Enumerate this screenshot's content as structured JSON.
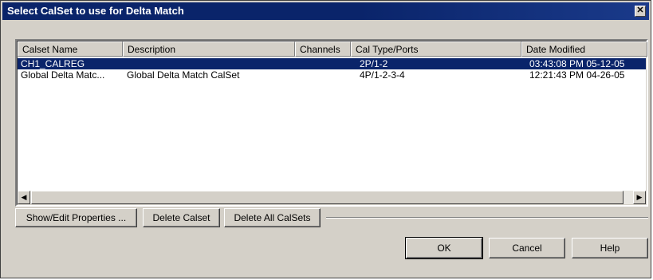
{
  "window": {
    "title": "Select CalSet to use for Delta Match",
    "close_glyph": "✕"
  },
  "list": {
    "columns": [
      "Calset Name",
      "Description",
      "Channels",
      "Cal Type/Ports",
      "Date Modified"
    ],
    "rows": [
      {
        "name": "CH1_CALREG",
        "description": "",
        "channels": "",
        "cal_type": "2P/1-2",
        "date": "03:43:08 PM  05-12-05",
        "selected": true
      },
      {
        "name": "Global Delta Matc...",
        "description": "Global Delta Match CalSet",
        "channels": "",
        "cal_type": "4P/1-2-3-4",
        "date": "12:21:43 PM  04-26-05",
        "selected": false
      }
    ],
    "scroll_left_glyph": "◀",
    "scroll_right_glyph": "▶"
  },
  "actions": {
    "show_edit": "Show/Edit Properties ...",
    "delete": "Delete Calset",
    "delete_all": "Delete All CalSets"
  },
  "footer": {
    "ok": "OK",
    "cancel": "Cancel",
    "help": "Help"
  },
  "colors": {
    "title_bar": "#0a246a",
    "selection": "#0a246a",
    "face": "#d4d0c8"
  }
}
